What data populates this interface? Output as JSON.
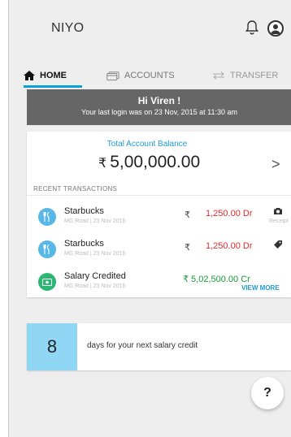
{
  "app": {
    "title": "NIYO"
  },
  "tabs": [
    {
      "label": "HOME",
      "icon": "home-icon",
      "active": true
    },
    {
      "label": "ACCOUNTS",
      "icon": "card-icon"
    },
    {
      "label": "TRANSFER",
      "icon": "transfer-icon"
    }
  ],
  "welcome": {
    "greeting": "Hi Viren !",
    "last_login": "Your last login was on 23 Nov, 2015 at 11:30 am"
  },
  "balance": {
    "label": "Total Account Balance",
    "currency": "₹",
    "value": "5,00,000.00"
  },
  "recent": {
    "title": "RECENT TRANSACTIONS",
    "view_more": "VIEW MORE",
    "items": [
      {
        "name": "Starbucks",
        "sub": "MG Road | 23 Nov 2015",
        "currency": "₹",
        "amount": "1,250.00 Dr",
        "action_icon": "camera-icon",
        "action_label": "Receipt",
        "color": "#57b8e8"
      },
      {
        "name": "Starbucks",
        "sub": "MG Road | 23 Nov 2015",
        "currency": "₹",
        "amount": "1,250.00 Dr",
        "action_icon": "tag-icon",
        "color": "#57b8e8"
      },
      {
        "name": "Salary Credited",
        "sub": "MG Road | 23 Nov 2015",
        "amount": "₹ 5,02,500.00 Cr",
        "color": "#2bb673"
      }
    ]
  },
  "salary": {
    "days": "8",
    "text": "days for your next salary credit"
  },
  "help": {
    "label": "?"
  },
  "colors": {
    "accent": "#0aa0d8",
    "debit": "#e32a2a",
    "credit": "#1a9a3a",
    "salary_box": "#8fd7f5"
  }
}
